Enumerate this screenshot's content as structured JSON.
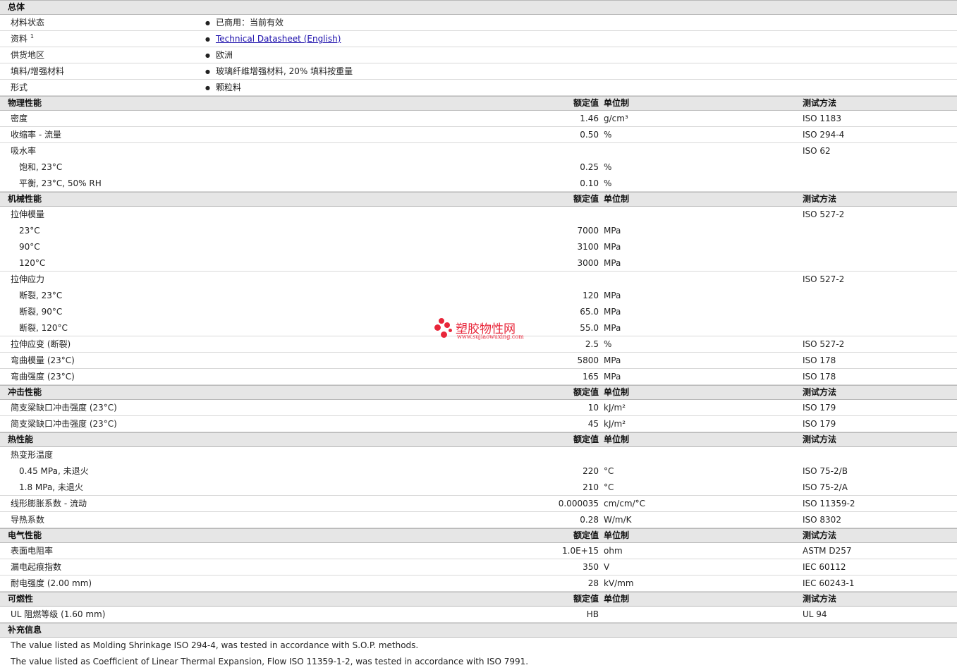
{
  "general": {
    "title": "总体",
    "rows": [
      {
        "name": "材料状态",
        "value": "已商用：当前有效"
      },
      {
        "name": "资料",
        "sup": "1",
        "value": "Technical Datasheet (English)",
        "link": true
      },
      {
        "name": "供货地区",
        "value": "欧洲"
      },
      {
        "name": "填料/增强材料",
        "value": "玻璃纤维增强材料, 20% 填料按重量"
      },
      {
        "name": "形式",
        "value": "颗粒料"
      }
    ]
  },
  "column_headers": {
    "value": "额定值",
    "unit": "单位制",
    "test": "测试方法"
  },
  "sections": [
    {
      "title": "物理性能",
      "rows": [
        {
          "name": "密度",
          "value": "1.46",
          "unit": "g/cm³",
          "test": "ISO 1183"
        },
        {
          "name": "收缩率 - 流量",
          "value": "0.50",
          "unit": "%",
          "test": "ISO 294-4"
        },
        {
          "name": "吸水率",
          "value": "",
          "unit": "",
          "test": "ISO 62",
          "group": true
        },
        {
          "name": "饱和, 23°C",
          "value": "0.25",
          "unit": "%",
          "test": "",
          "sub": true
        },
        {
          "name": "平衡, 23°C, 50% RH",
          "value": "0.10",
          "unit": "%",
          "test": "",
          "sub": true
        }
      ]
    },
    {
      "title": "机械性能",
      "rows": [
        {
          "name": "拉伸模量",
          "value": "",
          "unit": "",
          "test": "ISO 527-2",
          "group": true
        },
        {
          "name": "23°C",
          "value": "7000",
          "unit": "MPa",
          "test": "",
          "sub": true
        },
        {
          "name": "90°C",
          "value": "3100",
          "unit": "MPa",
          "test": "",
          "sub": true
        },
        {
          "name": "120°C",
          "value": "3000",
          "unit": "MPa",
          "test": "",
          "sub": true
        },
        {
          "name": "拉伸应力",
          "value": "",
          "unit": "",
          "test": "ISO 527-2",
          "group": true
        },
        {
          "name": "断裂, 23°C",
          "value": "120",
          "unit": "MPa",
          "test": "",
          "sub": true
        },
        {
          "name": "断裂, 90°C",
          "value": "65.0",
          "unit": "MPa",
          "test": "",
          "sub": true
        },
        {
          "name": "断裂, 120°C",
          "value": "55.0",
          "unit": "MPa",
          "test": "",
          "sub": true
        },
        {
          "name": "拉伸应变 (断裂)",
          "value": "2.5",
          "unit": "%",
          "test": "ISO 527-2"
        },
        {
          "name": "弯曲模量 (23°C)",
          "value": "5800",
          "unit": "MPa",
          "test": "ISO 178"
        },
        {
          "name": "弯曲强度 (23°C)",
          "value": "165",
          "unit": "MPa",
          "test": "ISO 178"
        }
      ]
    },
    {
      "title": "冲击性能",
      "rows": [
        {
          "name": "简支梁缺口冲击强度 (23°C)",
          "value": "10",
          "unit": "kJ/m²",
          "test": "ISO 179"
        },
        {
          "name": "简支梁缺口冲击强度 (23°C)",
          "value": "45",
          "unit": "kJ/m²",
          "test": "ISO 179"
        }
      ]
    },
    {
      "title": "热性能",
      "rows": [
        {
          "name": "热变形温度",
          "value": "",
          "unit": "",
          "test": "",
          "group": true
        },
        {
          "name": "0.45 MPa, 未退火",
          "value": "220",
          "unit": "°C",
          "test": "ISO 75-2/B",
          "sub": true
        },
        {
          "name": "1.8 MPa, 未退火",
          "value": "210",
          "unit": "°C",
          "test": "ISO 75-2/A",
          "sub": true
        },
        {
          "name": "线形膨胀系数 - 流动",
          "value": "0.000035",
          "unit": "cm/cm/°C",
          "test": "ISO 11359-2"
        },
        {
          "name": "导热系数",
          "value": "0.28",
          "unit": "W/m/K",
          "test": "ISO 8302"
        }
      ]
    },
    {
      "title": "电气性能",
      "rows": [
        {
          "name": "表面电阻率",
          "value": "1.0E+15",
          "unit": "ohm",
          "test": "ASTM D257"
        },
        {
          "name": "漏电起痕指数",
          "value": "350",
          "unit": "V",
          "test": "IEC 60112"
        },
        {
          "name": "耐电强度 (2.00 mm)",
          "value": "28",
          "unit": "kV/mm",
          "test": "IEC 60243-1"
        }
      ]
    },
    {
      "title": "可燃性",
      "rows": [
        {
          "name": "UL 阻燃等级 (1.60 mm)",
          "value": "HB",
          "unit": "",
          "test": "UL 94"
        }
      ]
    }
  ],
  "supplementary": {
    "title": "补充信息",
    "notes": [
      "The value listed as Molding Shrinkage ISO 294-4, was tested in accordance with S.O.P. methods.",
      "The value listed as Coefficient of Linear Thermal Expansion, Flow ISO 11359-1-2, was tested in accordance with ISO 7991."
    ]
  },
  "watermark": {
    "text": "塑胶物性网",
    "url": "www.sujiaowuxing.com",
    "color": "#e8263a"
  }
}
